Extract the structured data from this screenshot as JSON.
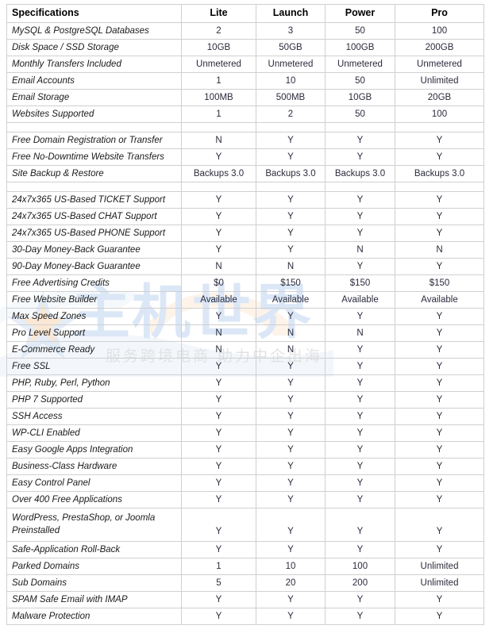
{
  "table": {
    "columns": [
      "Specifications",
      "Lite",
      "Launch",
      "Power",
      "Pro"
    ],
    "rows": [
      {
        "type": "row",
        "label": "MySQL & PostgreSQL Databases",
        "values": [
          "2",
          "3",
          "50",
          "100"
        ]
      },
      {
        "type": "row",
        "label": "Disk Space / SSD Storage",
        "values": [
          "10GB",
          "50GB",
          "100GB",
          "200GB"
        ]
      },
      {
        "type": "row",
        "label": "Monthly Transfers Included",
        "values": [
          "Unmetered",
          "Unmetered",
          "Unmetered",
          "Unmetered"
        ]
      },
      {
        "type": "row",
        "label": "Email Accounts",
        "values": [
          "1",
          "10",
          "50",
          "Unlimited"
        ]
      },
      {
        "type": "row",
        "label": "Email Storage",
        "values": [
          "100MB",
          "500MB",
          "10GB",
          "20GB"
        ]
      },
      {
        "type": "row",
        "label": "Websites Supported",
        "values": [
          "1",
          "2",
          "50",
          "100"
        ]
      },
      {
        "type": "spacer",
        "label": "",
        "values": [
          "",
          "",
          "",
          ""
        ]
      },
      {
        "type": "row",
        "label": "Free Domain Registration or Transfer",
        "values": [
          "N",
          "Y",
          "Y",
          "Y"
        ]
      },
      {
        "type": "row",
        "label": "Free No-Downtime Website Transfers",
        "values": [
          "Y",
          "Y",
          "Y",
          "Y"
        ]
      },
      {
        "type": "row",
        "label": "Site Backup & Restore",
        "values": [
          "Backups 3.0",
          "Backups 3.0",
          "Backups 3.0",
          "Backups 3.0"
        ]
      },
      {
        "type": "spacer",
        "label": "",
        "values": [
          "",
          "",
          "",
          ""
        ]
      },
      {
        "type": "row",
        "label": "24x7x365 US-Based TICKET Support",
        "values": [
          "Y",
          "Y",
          "Y",
          "Y"
        ]
      },
      {
        "type": "row",
        "label": "24x7x365 US-Based CHAT Support",
        "values": [
          "Y",
          "Y",
          "Y",
          "Y"
        ]
      },
      {
        "type": "row",
        "label": "24x7x365 US-Based PHONE Support",
        "values": [
          "Y",
          "Y",
          "Y",
          "Y"
        ]
      },
      {
        "type": "row",
        "label": "30-Day Money-Back Guarantee",
        "values": [
          "Y",
          "Y",
          "N",
          "N"
        ]
      },
      {
        "type": "row",
        "label": "90-Day Money-Back Guarantee",
        "values": [
          "N",
          "N",
          "Y",
          "Y"
        ]
      },
      {
        "type": "row",
        "label": "Free Advertising Credits",
        "values": [
          "$0",
          "$150",
          "$150",
          "$150"
        ]
      },
      {
        "type": "row",
        "label": "Free Website Builder",
        "values": [
          "Available",
          "Available",
          "Available",
          "Available"
        ]
      },
      {
        "type": "row",
        "label": "Max Speed Zones",
        "values": [
          "Y",
          "Y",
          "Y",
          "Y"
        ]
      },
      {
        "type": "row",
        "label": "Pro Level Support",
        "values": [
          "N",
          "N",
          "N",
          "Y"
        ]
      },
      {
        "type": "row",
        "label": "E-Commerce Ready",
        "values": [
          "N",
          "N",
          "Y",
          "Y"
        ]
      },
      {
        "type": "row",
        "label": "Free SSL",
        "values": [
          "Y",
          "Y",
          "Y",
          "Y"
        ]
      },
      {
        "type": "row",
        "label": "PHP, Ruby, Perl, Python",
        "values": [
          "Y",
          "Y",
          "Y",
          "Y"
        ]
      },
      {
        "type": "row",
        "label": "PHP 7 Supported",
        "values": [
          "Y",
          "Y",
          "Y",
          "Y"
        ]
      },
      {
        "type": "row",
        "label": "SSH Access",
        "values": [
          "Y",
          "Y",
          "Y",
          "Y"
        ]
      },
      {
        "type": "row",
        "label": "WP-CLI Enabled",
        "values": [
          "Y",
          "Y",
          "Y",
          "Y"
        ]
      },
      {
        "type": "row",
        "label": "Easy Google Apps Integration",
        "values": [
          "Y",
          "Y",
          "Y",
          "Y"
        ]
      },
      {
        "type": "row",
        "label": "Business-Class Hardware",
        "values": [
          "Y",
          "Y",
          "Y",
          "Y"
        ]
      },
      {
        "type": "row",
        "label": "Easy Control Panel",
        "values": [
          "Y",
          "Y",
          "Y",
          "Y"
        ]
      },
      {
        "type": "row",
        "label": "Over 400 Free Applications",
        "values": [
          "Y",
          "Y",
          "Y",
          "Y"
        ]
      },
      {
        "type": "tall",
        "label": "WordPress, PrestaShop, or Joomla Preinstalled",
        "values": [
          "Y",
          "Y",
          "Y",
          "Y"
        ]
      },
      {
        "type": "row",
        "label": "Safe-Application Roll-Back",
        "values": [
          "Y",
          "Y",
          "Y",
          "Y"
        ]
      },
      {
        "type": "row",
        "label": "Parked Domains",
        "values": [
          "1",
          "10",
          "100",
          "Unlimited"
        ]
      },
      {
        "type": "row",
        "label": "Sub Domains",
        "values": [
          "5",
          "20",
          "200",
          "Unlimited"
        ]
      },
      {
        "type": "row",
        "label": "SPAM Safe Email with IMAP",
        "values": [
          "Y",
          "Y",
          "Y",
          "Y"
        ]
      },
      {
        "type": "row",
        "label": "Malware Protection",
        "values": [
          "Y",
          "Y",
          "Y",
          "Y"
        ]
      }
    ]
  },
  "watermark": {
    "headline": "主机世界",
    "tagline": "服务跨境电商  助力中企出海",
    "colors": {
      "headline": "#dbe7f6",
      "tagline": "#e2e2e2",
      "swoosh": "#e8f0fa",
      "accent_orange": "#fbe6d0"
    }
  },
  "style": {
    "border_color": "#d0d0d0",
    "text_color": "#1a1a1a",
    "value_color": "#2b2b3d",
    "background": "#ffffff"
  }
}
